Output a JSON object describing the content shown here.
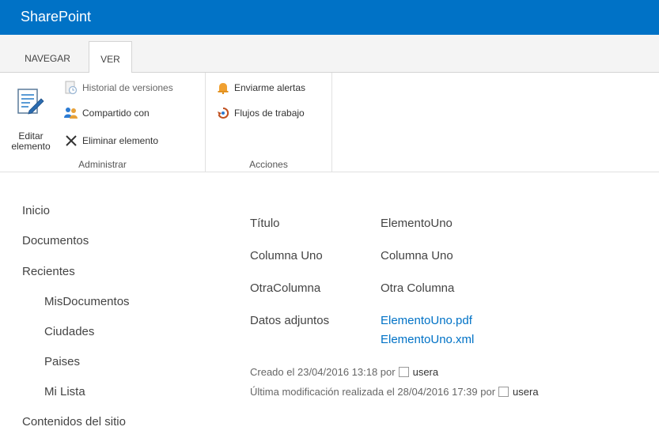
{
  "app": {
    "brand": "SharePoint"
  },
  "tabs": [
    {
      "label": "NAVEGAR"
    },
    {
      "label": "VER"
    }
  ],
  "ribbon": {
    "administrar": {
      "label": "Administrar",
      "editar_line1": "Editar",
      "editar_line2": "elemento",
      "historial": "Historial de versiones",
      "compartido": "Compartido con",
      "eliminar": "Eliminar elemento"
    },
    "acciones": {
      "label": "Acciones",
      "alertas": "Enviarme alertas",
      "flujos": "Flujos de trabajo"
    }
  },
  "nav": [
    "Inicio",
    "Documentos",
    "Recientes",
    "MisDocumentos",
    "Ciudades",
    "Paises",
    "Mi Lista",
    "Contenidos del sitio"
  ],
  "fields": [
    {
      "label": "Título",
      "value": "ElementoUno"
    },
    {
      "label": "Columna Uno",
      "value": "Columna Uno"
    },
    {
      "label": "OtraColumna",
      "value": "Otra Columna"
    },
    {
      "label": "Datos adjuntos",
      "attachments": [
        "ElementoUno.pdf",
        "ElementoUno.xml"
      ]
    }
  ],
  "meta": {
    "created": "Creado el 23/04/2016 13:18  por",
    "created_user": "usera",
    "modified": "Última modificación realizada el 28/04/2016 17:39  por",
    "modified_user": "usera"
  },
  "colors": {
    "suitebar": "#0072c6",
    "link": "#0072c6"
  }
}
